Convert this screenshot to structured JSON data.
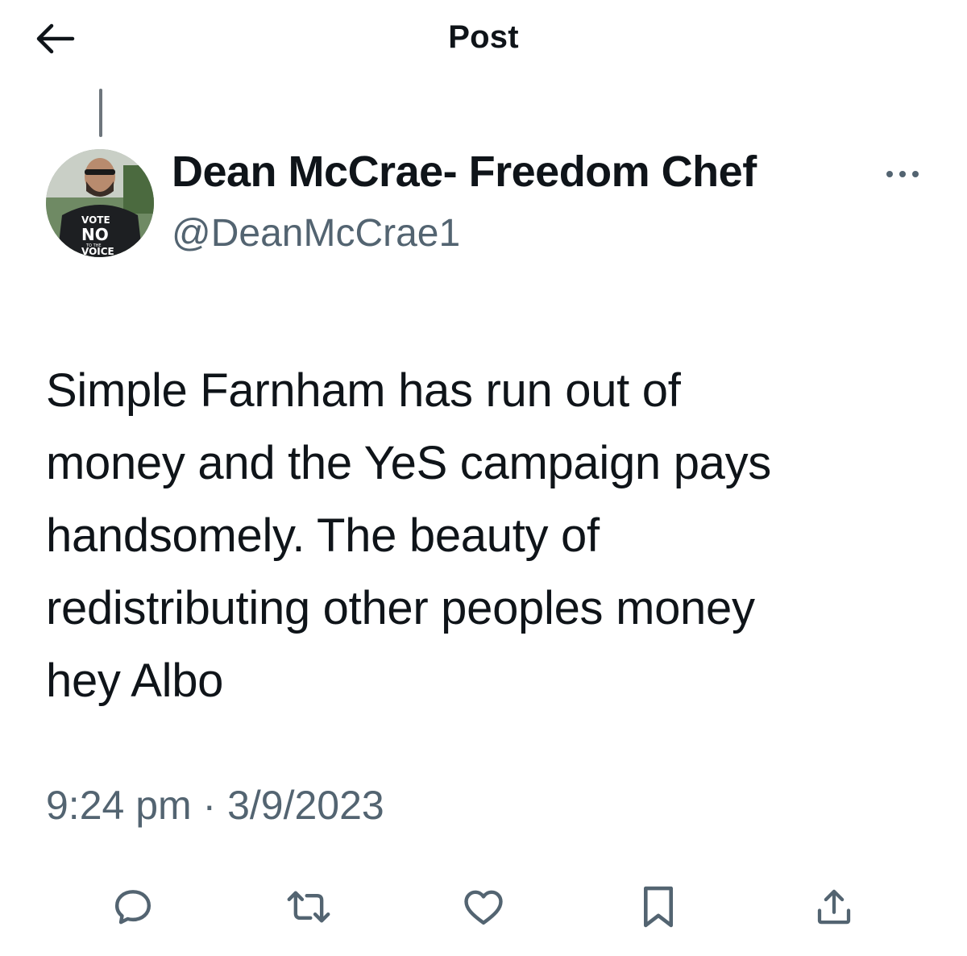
{
  "header": {
    "title": "Post",
    "back_icon": "arrow-left-icon"
  },
  "post": {
    "author": {
      "display_name": "Dean McCrae- Freedom Chef",
      "handle": "@DeanMcCrae1",
      "avatar_shirt_text": [
        "VOTE",
        "NO",
        "TO THE",
        "VOICE"
      ]
    },
    "text": "Simple Farnham has run out of\nmoney and the YeS campaign pays\nhandsomely. The beauty of\nredistributing other peoples money\nhey Albo",
    "timestamp": "9:24 pm · 3/9/2023"
  },
  "actions": [
    {
      "name": "reply",
      "icon": "reply-icon"
    },
    {
      "name": "repost",
      "icon": "repost-icon"
    },
    {
      "name": "like",
      "icon": "heart-icon"
    },
    {
      "name": "bookmark",
      "icon": "bookmark-icon"
    },
    {
      "name": "share",
      "icon": "share-icon"
    }
  ],
  "colors": {
    "text": "#0f1419",
    "secondary": "#536471"
  }
}
